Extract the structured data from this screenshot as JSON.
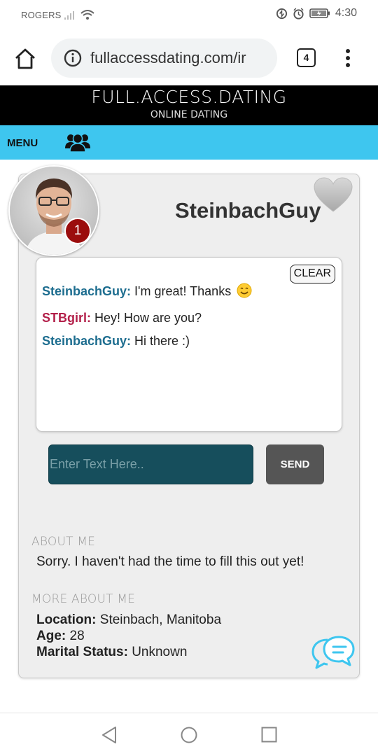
{
  "status_bar": {
    "carrier": "ROGERS",
    "time": "4:30"
  },
  "browser": {
    "url": "fullaccessdating.com/ir",
    "tab_count": "4"
  },
  "site": {
    "title": "FULL.ACCESS.DATING",
    "subtitle": "ONLINE DATING"
  },
  "menu": {
    "label": "MENU"
  },
  "profile": {
    "username": "SteinbachGuy",
    "notification_count": "1"
  },
  "chat": {
    "clear_label": "CLEAR",
    "messages": [
      {
        "sender": "SteinbachGuy:",
        "text": " I'm great! Thanks",
        "emoji": true
      },
      {
        "sender": "STBgirl:",
        "text": " Hey! How are you?",
        "emoji": false
      },
      {
        "sender": "SteinbachGuy:",
        "text": " Hi there :)",
        "emoji": false
      }
    ],
    "input_placeholder": "Enter Text Here..",
    "send_label": "SEND"
  },
  "about": {
    "title": "ABOUT ME",
    "text": "Sorry. I haven't had the time to fill this out yet!"
  },
  "more_about": {
    "title": "MORE ABOUT ME",
    "location_label": "Location:",
    "location_value": " Steinbach, Manitoba",
    "age_label": "Age:",
    "age_value": " 28",
    "marital_label": "Marital Status:",
    "marital_value": " Unknown"
  },
  "colors": {
    "menu_bar": "#3ec6ef",
    "input_bg": "#164e5c",
    "send_bg": "#555555",
    "badge": "#9b0d0d",
    "sender_a": "#1d6d8f",
    "sender_b": "#b3204a"
  },
  "icons": [
    "home-icon",
    "info-icon",
    "more-vert-icon",
    "people-icon",
    "heart-icon",
    "smile-emoji-icon",
    "chat-bubbles-icon",
    "back-icon",
    "home-circle-icon",
    "recents-icon"
  ]
}
